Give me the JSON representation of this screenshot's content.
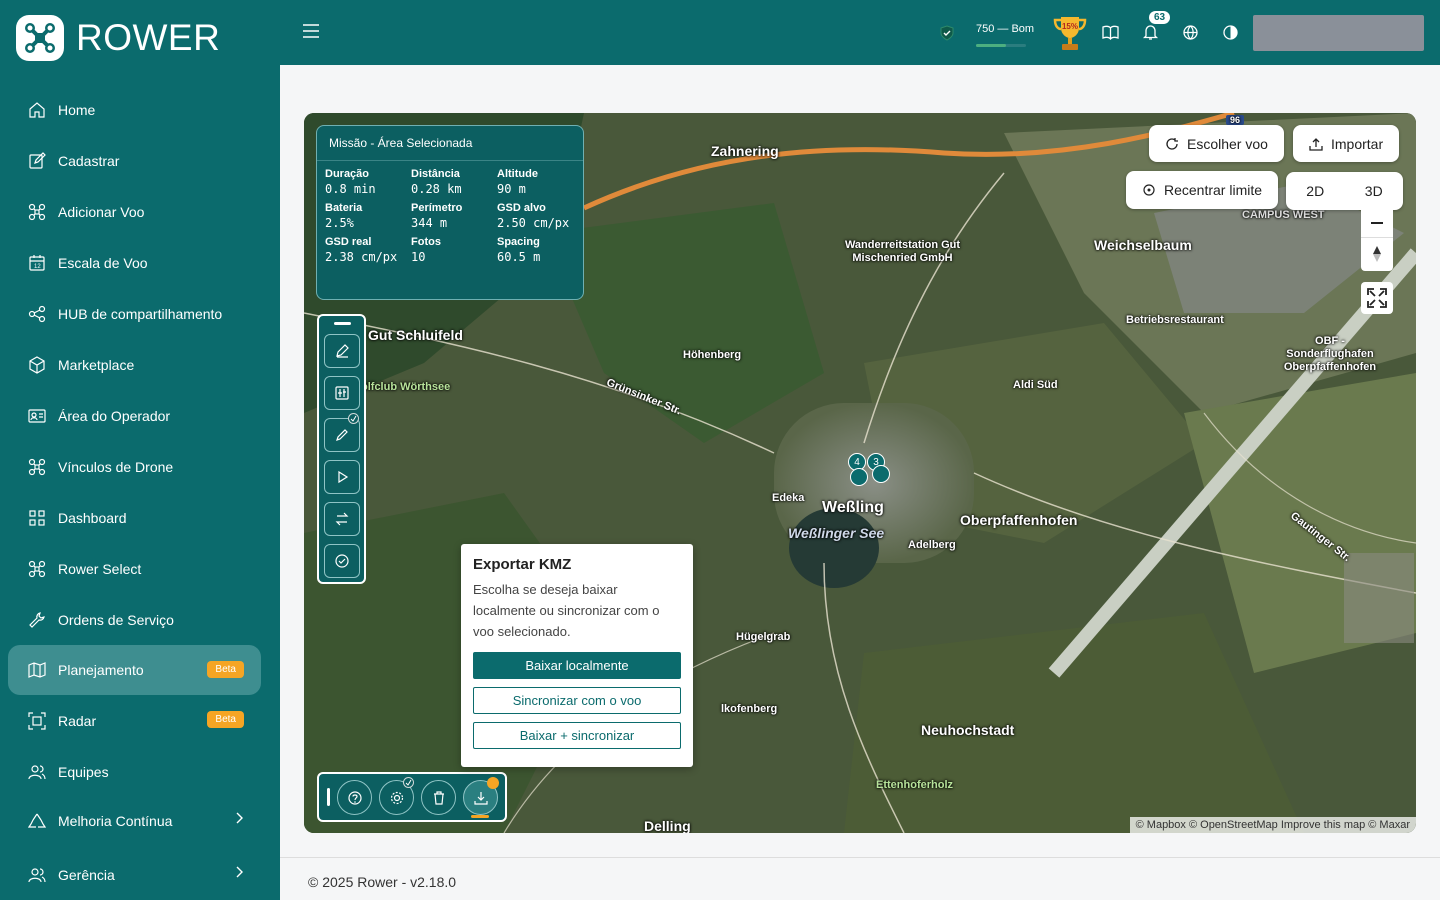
{
  "app": {
    "name": "ROWER"
  },
  "sidebar": {
    "items": [
      {
        "label": "Home",
        "icon": "home-icon"
      },
      {
        "label": "Cadastrar",
        "icon": "edit-icon"
      },
      {
        "label": "Adicionar Voo",
        "icon": "drone-icon"
      },
      {
        "label": "Escala de Voo",
        "icon": "calendar-icon"
      },
      {
        "label": "HUB de compartilhamento",
        "icon": "share-icon"
      },
      {
        "label": "Marketplace",
        "icon": "box-icon"
      },
      {
        "label": "Área do Operador",
        "icon": "id-card-icon"
      },
      {
        "label": "Vínculos de Drone",
        "icon": "drone-icon"
      },
      {
        "label": "Dashboard",
        "icon": "grid-icon"
      },
      {
        "label": "Rower Select",
        "icon": "drone-icon"
      },
      {
        "label": "Ordens de Serviço",
        "icon": "wrench-icon"
      },
      {
        "label": "Planejamento",
        "icon": "map-icon",
        "badge": "Beta",
        "active": true
      },
      {
        "label": "Radar",
        "icon": "radar-icon",
        "badge": "Beta"
      },
      {
        "label": "Equipes",
        "icon": "users-icon"
      },
      {
        "label": "Melhoria Contínua",
        "icon": "recycle-icon",
        "expandable": true
      },
      {
        "label": "Gerência",
        "icon": "users-icon",
        "expandable": true
      }
    ]
  },
  "header": {
    "score_text": "750 — Bom",
    "trophy_text": "15%",
    "notifications_count": "63"
  },
  "mission": {
    "title": "Missão - Área Selecionada",
    "stats": [
      {
        "label": "Duração",
        "value": "0.8 min"
      },
      {
        "label": "Distância",
        "value": "0.28 km"
      },
      {
        "label": "Altitude",
        "value": "90 m"
      },
      {
        "label": "Bateria",
        "value": "2.5%"
      },
      {
        "label": "Perímetro",
        "value": "344 m"
      },
      {
        "label": "GSD alvo",
        "value": "2.50 cm/px"
      },
      {
        "label": "GSD real",
        "value": "2.38 cm/px"
      },
      {
        "label": "Fotos",
        "value": "10"
      },
      {
        "label": "Spacing",
        "value": "60.5 m"
      }
    ]
  },
  "export": {
    "title": "Exportar KMZ",
    "description": "Escolha se deseja baixar localmente ou sincronizar com o voo selecionado.",
    "btn_local": "Baixar localmente",
    "btn_sync": "Sincronizar com o voo",
    "btn_both": "Baixar + sincronizar"
  },
  "map_controls": {
    "choose_flight": "Escolher voo",
    "import": "Importar",
    "recenter": "Recentrar limite",
    "view_2d": "2D",
    "view_3d": "3D"
  },
  "map_labels": {
    "zahnering": "Zahnering",
    "wanderreit": "Wanderreitstation Gut Mischenried GmbH",
    "weichselbaum": "Weichselbaum",
    "campus": "CAMPUS WEST",
    "betriebs": "Betriebsrestaurant",
    "obf": "OBF - Sonderflughafen Oberpfaffenhofen",
    "gut": "Gut Schluifeld",
    "golf": "olfclub Wörthsee",
    "hoehenberg": "Höhenberg",
    "gruensink": "Grünsinker Str.",
    "aldi": "Aldi Süd",
    "edeka": "Edeka",
    "wessling": "Weßling",
    "see": "Weßlinger See",
    "oberpf": "Oberpfaffenhofen",
    "adelberg": "Adelberg",
    "gauting": "Gautinger Str.",
    "huegel": "Hügelgrab",
    "lkofen": "lkofenberg",
    "neuhoch": "Neuhochstadt",
    "etten": "Ettenhoferholz",
    "delling": "Delling",
    "road_96": "96",
    "clusters": [
      "4",
      "3"
    ]
  },
  "attribution": "© Mapbox © OpenStreetMap Improve this map © Maxar",
  "footer": "© 2025 Rower - v2.18.0",
  "colors": {
    "primary": "#0b6b6d",
    "active": "#3e8e90",
    "badge": "#f5a524"
  }
}
